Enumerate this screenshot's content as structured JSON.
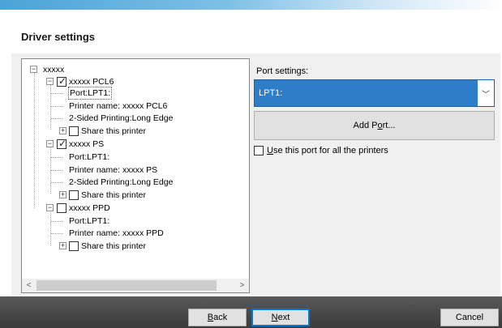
{
  "header": {
    "title": "Driver settings"
  },
  "tree": {
    "root": {
      "label": "xxxxx",
      "expander": "−"
    },
    "printers": [
      {
        "name": "xxxxx PCL6",
        "checked": true,
        "expander": "−",
        "port": "Port:LPT1:",
        "printer_name": "Printer name: xxxxx PCL6",
        "duplex": "2-Sided Printing:Long Edge",
        "share": {
          "label": "Share this printer",
          "checked": false,
          "expander": "+"
        }
      },
      {
        "name": "xxxxx PS",
        "checked": true,
        "expander": "−",
        "port": "Port:LPT1:",
        "printer_name": "Printer name: xxxxx PS",
        "duplex": "2-Sided Printing:Long Edge",
        "share": {
          "label": "Share this printer",
          "checked": false,
          "expander": "+"
        }
      },
      {
        "name": "xxxxx PPD",
        "checked": false,
        "expander": "−",
        "port": "Port:LPT1:",
        "printer_name": "Printer name: xxxxx PPD",
        "share": {
          "label": "Share this printer",
          "checked": false,
          "expander": "+"
        }
      }
    ],
    "scroll_left": "<",
    "scroll_right": ">"
  },
  "port_settings": {
    "label": "Port settings:",
    "selected": "LPT1:",
    "dropdown_arrow": "﹀",
    "add_port_pre": "Add P",
    "add_port_mnemonic": "o",
    "add_port_post": "rt...",
    "use_for_all_mnemonic": "U",
    "use_for_all_rest": "se this port for all the printers",
    "use_for_all_checked": false
  },
  "footer": {
    "back_mnemonic": "B",
    "back_rest": "ack",
    "next_mnemonic": "N",
    "next_rest": "ext",
    "cancel": "Cancel"
  },
  "colors": {
    "accent": "#2e7dc8",
    "bar": "#3a3a3a",
    "selection_text": "#ffffff"
  }
}
